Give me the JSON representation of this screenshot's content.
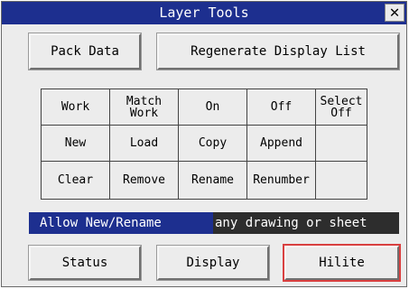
{
  "window": {
    "title": "Layer Tools",
    "close_icon": "close-icon"
  },
  "top_buttons": {
    "pack": "Pack Data",
    "regenerate": "Regenerate Display List"
  },
  "grid": {
    "row1": [
      "Work",
      "Match\nWork",
      "On",
      "Off",
      "Select\nOff"
    ],
    "row2": [
      "New",
      "Load",
      "Copy",
      "Append",
      ""
    ],
    "row3": [
      "Clear",
      "Remove",
      "Rename",
      "Renumber",
      ""
    ]
  },
  "allow_bar": {
    "label": "Allow New/Rename",
    "value": "any drawing or sheet"
  },
  "bottom_buttons": {
    "status": "Status",
    "display": "Display",
    "hilite": "Hilite"
  },
  "colors": {
    "title_bg": "#1d2f8f",
    "hilite_border": "#d94040"
  }
}
